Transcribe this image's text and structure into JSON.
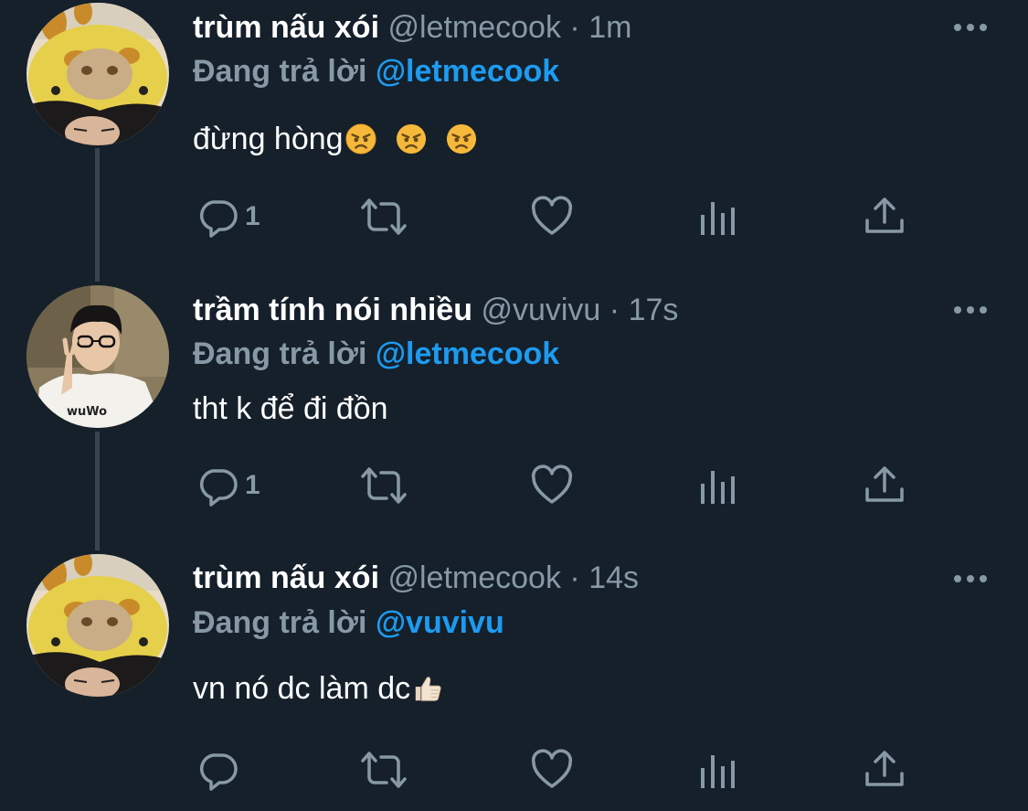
{
  "tweets": [
    {
      "display_name": "trùm nấu xói",
      "handle": "@letmecook",
      "separator": "·",
      "time": "1m",
      "reply_prefix": "Đang trả lời",
      "reply_to": "@letmecook",
      "text": "đừng hòng",
      "emojis": [
        "angry-face",
        "angry-face",
        "angry-face"
      ],
      "reply_count": "1",
      "avatar": "giraffe-hat-avatar"
    },
    {
      "display_name": "trầm tính nói nhiều",
      "handle": "@vuvivu",
      "separator": "·",
      "time": "17s",
      "reply_prefix": "Đang trả lời",
      "reply_to": "@letmecook",
      "text": "tht k để đi đồn",
      "emojis": [],
      "reply_count": "1",
      "avatar": "glasses-boy-avatar"
    },
    {
      "display_name": "trùm nấu xói",
      "handle": "@letmecook",
      "separator": "·",
      "time": "14s",
      "reply_prefix": "Đang trả lời",
      "reply_to": "@vuvivu",
      "text": "vn nó dc làm dc",
      "emojis": [
        "thumbs-up"
      ],
      "reply_count": "",
      "avatar": "giraffe-hat-avatar"
    }
  ],
  "icons": {
    "more": "more-horizontal-icon",
    "reply": "reply-bubble-icon",
    "retweet": "retweet-icon",
    "like": "heart-icon",
    "analytics": "analytics-bars-icon",
    "share": "share-upload-icon"
  },
  "colors": {
    "background": "#15202b",
    "muted": "#8899a6",
    "accent": "#1d9bf0",
    "thread_line": "#38444d"
  }
}
